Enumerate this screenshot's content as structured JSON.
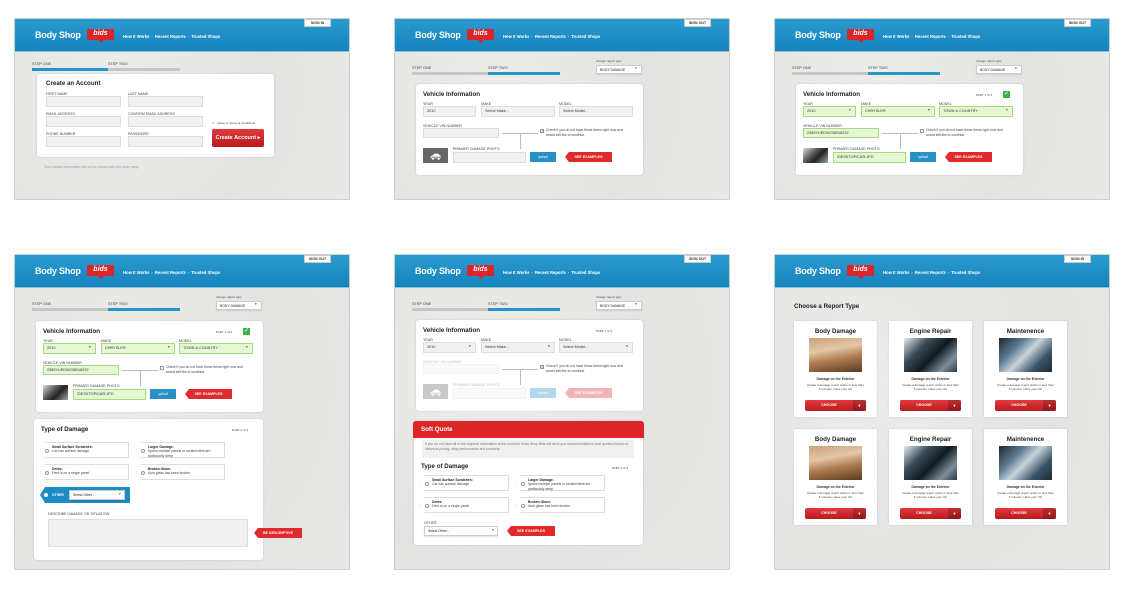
{
  "brand": {
    "name": "Body Shop",
    "badge": "bids"
  },
  "nav": {
    "items": [
      "How It Works",
      "Recent Reports",
      "Trusted Shops"
    ],
    "separator": "·"
  },
  "colors": {
    "header_blue": "#1c8fc6",
    "accent_red": "#d9262a",
    "valid_green": "#e6f8d3",
    "check_green": "#3bb54a"
  },
  "screens": [
    {
      "auth": "SIGN IN",
      "steps": [
        "STEP ONE",
        "STEP TWO"
      ],
      "active_step": 1,
      "form": {
        "title": "Create an Account",
        "fields": [
          {
            "label": "FIRST NAME",
            "value": ""
          },
          {
            "label": "LAST NAME",
            "value": ""
          },
          {
            "label": "EMAIL ADDRESS",
            "value": ""
          },
          {
            "label": "CONFIRM EMAIL ADDRESS",
            "value": ""
          },
          {
            "label": "PHONE NUMBER",
            "value": ""
          },
          {
            "label": "PASSWORD",
            "value": ""
          }
        ],
        "terms": "Agree to Terms & Conditions",
        "terms_checked": true,
        "submit": "Create Account ▸"
      },
      "note": "Your contact information will not be shared with any other party."
    },
    {
      "auth": "SIGN OUT",
      "steps": [
        "STEP ONE",
        "STEP TWO"
      ],
      "active_step": 2,
      "report_type_label": "change report type",
      "report_type": "BODY DAMAGE",
      "vehicle": {
        "title": "Vehicle Information",
        "part": "",
        "complete": false,
        "year": {
          "label": "YEAR",
          "value": "2010"
        },
        "make": {
          "label": "MAKE",
          "value": "Select Make..."
        },
        "model": {
          "label": "MODEL",
          "value": "Select Model..."
        },
        "vin": {
          "label": "VEHICLE VIN NUMBER",
          "value": ""
        },
        "skip": "Check if you do not have these items right now and would still like to continue.",
        "skip_checked": true,
        "photo": {
          "label": "PRIMARY DAMAGE PHOTO",
          "value": ""
        },
        "upload": "upload",
        "examples": "SEE EXAMPLES"
      }
    },
    {
      "auth": "SIGN OUT",
      "steps": [
        "STEP ONE",
        "STEP TWO"
      ],
      "active_step": 2,
      "report_type_label": "change report type",
      "report_type": "BODY DAMAGE",
      "vehicle": {
        "title": "Vehicle Information",
        "part": "PART 1 of 3",
        "complete": true,
        "year": {
          "label": "YEAR",
          "value": "2010"
        },
        "make": {
          "label": "MAKE",
          "value": "CHRYSLER"
        },
        "model": {
          "label": "MODEL",
          "value": "TOWN & COUNTRY"
        },
        "vin": {
          "label": "VEHICLE VIN NUMBER",
          "value": "2389YUEDW238918292"
        },
        "skip": "Check if you do not have these items right now and would still like to continue.",
        "skip_checked": false,
        "photo": {
          "label": "PRIMARY DAMAGE PHOTO",
          "value": "/DESKTOP/CAR.JPG"
        },
        "upload": "upload",
        "examples": "SEE EXAMPLES"
      }
    },
    {
      "auth": "SIGN OUT",
      "steps": [
        "STEP ONE",
        "STEP TWO"
      ],
      "active_step": 2,
      "report_type_label": "change report type",
      "report_type": "BODY DAMAGE",
      "vehicle": {
        "title": "Vehicle Information",
        "part": "PART 1 of 3",
        "complete": true,
        "year": {
          "label": "YEAR",
          "value": "2010"
        },
        "make": {
          "label": "MAKE",
          "value": "CHRYSLER"
        },
        "model": {
          "label": "MODEL",
          "value": "TOWN & COUNTRY"
        },
        "vin": {
          "label": "VEHICLE VIN NUMBER",
          "value": "2389YUEDW238918292"
        },
        "skip": "Check if you do not have these items right now and would still like to continue.",
        "skip_checked": false,
        "photo": {
          "label": "PRIMARY DAMAGE PHOTO",
          "value": "/DESKTOP/CAR.JPG"
        },
        "upload": "upload",
        "examples": "SEE EXAMPLES"
      },
      "damage": {
        "title": "Type of Damage",
        "part": "PART 2 of 3",
        "options": [
          {
            "title": "Small Surface Scratches:",
            "desc": "Car has surface damage"
          },
          {
            "title": "Larger Damage:",
            "desc": "Spans multiple panels or scratch/dent are particularly deep"
          },
          {
            "title": "Dents:",
            "desc": "Dent is on a single panel"
          },
          {
            "title": "Broken Glass:",
            "desc": "Auto glass has been broken"
          }
        ],
        "other_label": "OTHER",
        "other_value": "Select Other...",
        "other_selected": true,
        "describe_label": "DESCRIBE DAMAGE OR SITUATION",
        "describe_value": "",
        "hint": "BE DESCRIPTIVE"
      }
    },
    {
      "auth": "SIGN OUT",
      "steps": [
        "STEP ONE",
        "STEP TWO"
      ],
      "active_step": 2,
      "report_type_label": "change report type",
      "report_type": "BODY DAMAGE",
      "vehicle": {
        "title": "Vehicle Information",
        "part": "PART 1 of 3",
        "complete": false,
        "disabled": true,
        "year": {
          "label": "YEAR",
          "value": "2010"
        },
        "make": {
          "label": "MAKE",
          "value": "Select Make..."
        },
        "model": {
          "label": "MODEL",
          "value": "Select Model..."
        },
        "vin": {
          "label": "VEHICLE VIN NUMBER",
          "value": ""
        },
        "skip": "Check if you do not have these items right now and would still like to continue.",
        "skip_checked": true,
        "photo": {
          "label": "PRIMARY DAMAGE PHOTO",
          "value": ""
        },
        "upload": "upload",
        "examples": "SEE EXAMPLES"
      },
      "soft_quote": {
        "title": "Soft Quote",
        "info": "If you do not have all of the required information at the moment, Body Shop Bids will send you recommendations (soft quotes) based on historical pricing, shop performance and proximity."
      },
      "damage": {
        "title": "Type of Damage",
        "part": "PART 2 of 3",
        "options": [
          {
            "title": "Small Surface Scratches:",
            "desc": "Car has surface damage"
          },
          {
            "title": "Larger Damage:",
            "desc": "Spans multiple panels or scratch/dent are particularly deep"
          },
          {
            "title": "Dents:",
            "desc": "Dent is on a single panel"
          },
          {
            "title": "Broken Glass:",
            "desc": "Auto glass has been broken"
          }
        ],
        "other_label": "OTHER",
        "other_value": "Select Other...",
        "examples": "SEE EXAMPLES"
      }
    },
    {
      "auth": "SIGN IN",
      "title": "Choose a Report Type",
      "cards": [
        {
          "title": "Body Damage",
          "photo": "body-damage",
          "subtitle": "Damage on the Exterior",
          "desc": "Create a damage report online in less than 5 minutes. Have your Vin",
          "button": "CHOOSE"
        },
        {
          "title": "Engine Repair",
          "photo": "engine",
          "subtitle": "Damage on the Exterior",
          "desc": "Create a damage report online in less than 5 minutes. Have your Vin",
          "button": "CHOOSE"
        },
        {
          "title": "Maintenence",
          "photo": "mechanic",
          "subtitle": "Damage on the Exterior",
          "desc": "Create a damage report online in less than 5 minutes. Have your Vin",
          "button": "CHOOSE"
        },
        {
          "title": "Body Damage",
          "photo": "body-damage",
          "subtitle": "Damage on the Exterior",
          "desc": "Create a damage report online in less than 5 minutes. Have your Vin",
          "button": "CHOOSE"
        },
        {
          "title": "Engine Repair",
          "photo": "engine",
          "subtitle": "Damage on the Exterior",
          "desc": "Create a damage report online in less than 5 minutes. Have your Vin",
          "button": "CHOOSE"
        },
        {
          "title": "Maintenence",
          "photo": "mechanic",
          "subtitle": "Damage on the Exterior",
          "desc": "Create a damage report online in less than 5 minutes. Have your Vin",
          "button": "CHOOSE"
        }
      ]
    }
  ]
}
